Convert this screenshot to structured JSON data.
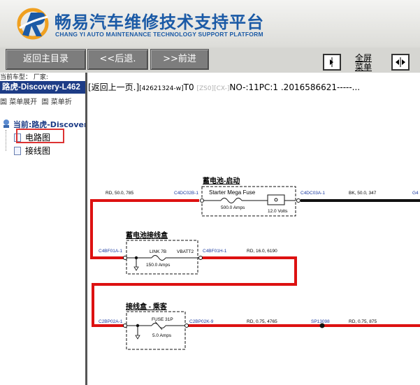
{
  "header": {
    "title_cn": "畅易汽车维修技术支持平台",
    "title_en": "CHANG YI AUTO MAINTENANCE TECHNOLOGY SUPPORT PLATFORM"
  },
  "toolbar": {
    "home_label": "返回主目录",
    "back_label": "<<后退.",
    "forward_label": ">>前进",
    "fullscreen_line1": "全屏",
    "fullscreen_line2": "菜单"
  },
  "info_line": "当前车型：  厂家:",
  "left_panel": {
    "vehicle": "路虎-Discovery-L462",
    "menu_expand": "菜单展开",
    "menu_collapse": "菜单折",
    "current": "当前:路虎-Discovery",
    "items": [
      {
        "label": "电路图",
        "selected": true
      },
      {
        "label": "接线图",
        "selected": false
      }
    ]
  },
  "content": {
    "back_link": "[返回上一页.]",
    "code": "[42621324-w]",
    "t0": "T0",
    "zs": "[ZS0]",
    "cx": "[CX-]",
    "no": "NO-:11PC:1 .2016586621-----..."
  },
  "diagram": {
    "wire_color": "#dd1111",
    "row1": {
      "left_wire": "RD, 50.0, 785",
      "left_conn": "C4DC02B-1",
      "title": "蓄电池-启动",
      "fuse": "Starter Mega Fuse",
      "rating": "500.0 Amps",
      "volts": "12.0 Volts",
      "right_conn": "C4DC03A-1",
      "right_wire": "BK, 50.0, 347",
      "edge": "G4"
    },
    "row2": {
      "title": "蓄电池接线盒",
      "left_conn": "C4BF01A-1",
      "link": "LINK 7B",
      "vbatt": "VBATT2",
      "rating": "150.0 Amps",
      "right_conn": "C4BF01H-1",
      "right_wire": "RD, 16.0, 6190"
    },
    "row3": {
      "title": "接线盒 - 乘客",
      "left_conn": "C2BP02A-1",
      "fuse": "FUSE 31P",
      "rating": "5.0 Amps",
      "right_conn": "C2BP02K-9",
      "wire1": "RD, 0.75, 4765",
      "splice": "SP13098",
      "wire2": "RD, 0.75, 875"
    }
  }
}
